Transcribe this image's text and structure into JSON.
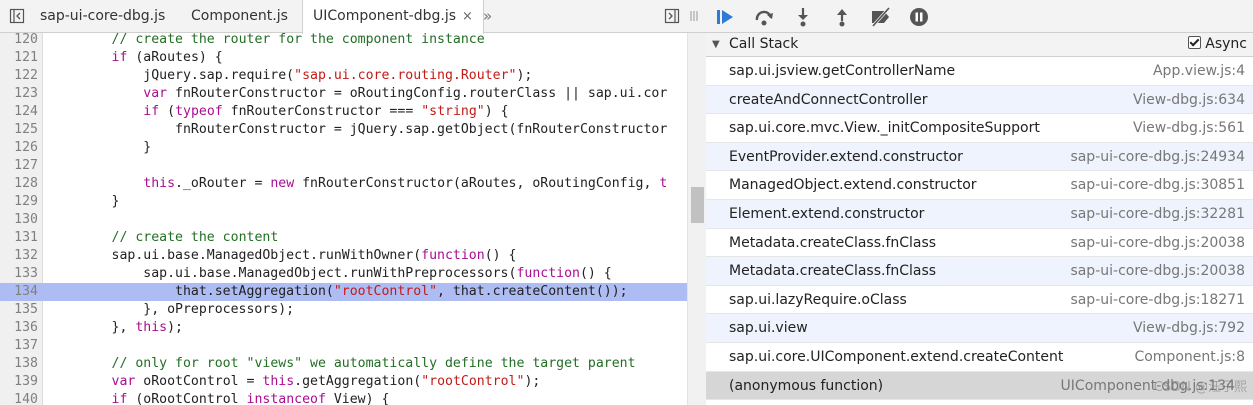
{
  "editor": {
    "tabs": [
      {
        "label": "sap-ui-core-dbg.js",
        "active": false
      },
      {
        "label": "Component.js",
        "active": false
      },
      {
        "label": "UIComponent-dbg.js",
        "active": true
      }
    ],
    "close_glyph": "×",
    "more_glyph": "»",
    "lines": [
      {
        "n": "120",
        "parts": [
          [
            "        ",
            ""
          ],
          [
            "// create the router for the component instance",
            "com"
          ]
        ]
      },
      {
        "n": "121",
        "parts": [
          [
            "        ",
            ""
          ],
          [
            "if",
            "kw"
          ],
          [
            " (aRoutes) {",
            ""
          ]
        ]
      },
      {
        "n": "122",
        "parts": [
          [
            "            jQuery.sap.require(",
            ""
          ],
          [
            "\"sap.ui.core.routing.Router\"",
            "str"
          ],
          [
            ");",
            ""
          ]
        ]
      },
      {
        "n": "123",
        "parts": [
          [
            "            ",
            ""
          ],
          [
            "var",
            "kw"
          ],
          [
            " fnRouterConstructor = oRoutingConfig.routerClass || sap.ui.cor",
            ""
          ]
        ]
      },
      {
        "n": "124",
        "parts": [
          [
            "            ",
            ""
          ],
          [
            "if",
            "kw"
          ],
          [
            " (",
            ""
          ],
          [
            "typeof",
            "kw"
          ],
          [
            " fnRouterConstructor === ",
            ""
          ],
          [
            "\"string\"",
            "str"
          ],
          [
            ") {",
            ""
          ]
        ]
      },
      {
        "n": "125",
        "parts": [
          [
            "                fnRouterConstructor = jQuery.sap.getObject(fnRouterConstructor",
            ""
          ]
        ]
      },
      {
        "n": "126",
        "parts": [
          [
            "            }",
            ""
          ]
        ]
      },
      {
        "n": "127",
        "parts": [
          [
            "",
            ""
          ]
        ]
      },
      {
        "n": "128",
        "parts": [
          [
            "            ",
            ""
          ],
          [
            "this",
            "kw"
          ],
          [
            "._oRouter = ",
            ""
          ],
          [
            "new",
            "kw"
          ],
          [
            " fnRouterConstructor(aRoutes, oRoutingConfig, ",
            ""
          ],
          [
            "t",
            "kw"
          ]
        ]
      },
      {
        "n": "129",
        "parts": [
          [
            "        }",
            ""
          ]
        ]
      },
      {
        "n": "130",
        "parts": [
          [
            "",
            ""
          ]
        ]
      },
      {
        "n": "131",
        "parts": [
          [
            "        ",
            ""
          ],
          [
            "// create the content",
            "com"
          ]
        ]
      },
      {
        "n": "132",
        "parts": [
          [
            "        sap.ui.base.ManagedObject.runWithOwner(",
            ""
          ],
          [
            "function",
            "kw"
          ],
          [
            "() {",
            ""
          ]
        ]
      },
      {
        "n": "133",
        "parts": [
          [
            "            sap.ui.base.ManagedObject.runWithPreprocessors(",
            ""
          ],
          [
            "function",
            "kw"
          ],
          [
            "() {",
            ""
          ]
        ]
      },
      {
        "n": "134",
        "highlight": true,
        "parts": [
          [
            "                that.setAggregation(",
            ""
          ],
          [
            "\"rootControl\"",
            "str"
          ],
          [
            ", that.createContent());",
            ""
          ]
        ]
      },
      {
        "n": "135",
        "parts": [
          [
            "            }, oPreprocessors);",
            ""
          ]
        ]
      },
      {
        "n": "136",
        "parts": [
          [
            "        }, ",
            ""
          ],
          [
            "this",
            "kw"
          ],
          [
            ");",
            ""
          ]
        ]
      },
      {
        "n": "137",
        "parts": [
          [
            "",
            ""
          ]
        ]
      },
      {
        "n": "138",
        "parts": [
          [
            "        ",
            ""
          ],
          [
            "// only for root \"views\" we automatically define the target parent",
            "com"
          ]
        ]
      },
      {
        "n": "139",
        "parts": [
          [
            "        ",
            ""
          ],
          [
            "var",
            "kw"
          ],
          [
            " oRootControl = ",
            ""
          ],
          [
            "this",
            "kw"
          ],
          [
            ".getAggregation(",
            ""
          ],
          [
            "\"rootControl\"",
            "str"
          ],
          [
            ");",
            ""
          ]
        ]
      },
      {
        "n": "140",
        "parts": [
          [
            "        ",
            ""
          ],
          [
            "if",
            "kw"
          ],
          [
            " (oRootControl ",
            ""
          ],
          [
            "instanceof",
            "kw"
          ],
          [
            " View) {",
            ""
          ]
        ]
      }
    ]
  },
  "debugger": {
    "toolbar_icons": [
      "resume-icon",
      "step-over-icon",
      "step-into-icon",
      "step-out-icon",
      "deactivate-breakpoints-icon",
      "pause-on-exceptions-icon"
    ],
    "call_stack_title": "Call Stack",
    "async_label": "Async",
    "async_checked": true,
    "frames": [
      {
        "name": "sap.ui.jsview.getControllerName",
        "loc": "App.view.js:4"
      },
      {
        "name": "createAndConnectController",
        "loc": "View-dbg.js:634"
      },
      {
        "name": "sap.ui.core.mvc.View._initCompositeSupport",
        "loc": "View-dbg.js:561"
      },
      {
        "name": "EventProvider.extend.constructor",
        "loc": "sap-ui-core-dbg.js:24934"
      },
      {
        "name": "ManagedObject.extend.constructor",
        "loc": "sap-ui-core-dbg.js:30851"
      },
      {
        "name": "Element.extend.constructor",
        "loc": "sap-ui-core-dbg.js:32281"
      },
      {
        "name": "Metadata.createClass.fnClass",
        "loc": "sap-ui-core-dbg.js:20038"
      },
      {
        "name": "Metadata.createClass.fnClass",
        "loc": "sap-ui-core-dbg.js:20038"
      },
      {
        "name": "sap.ui.lazyRequire.oClass",
        "loc": "sap-ui-core-dbg.js:18271"
      },
      {
        "name": "sap.ui.view",
        "loc": "View-dbg.js:792"
      },
      {
        "name": "sap.ui.core.UIComponent.extend.createContent",
        "loc": "Component.js:8"
      },
      {
        "name": "(anonymous function)",
        "loc": "UIComponent-dbg.js:134",
        "selected": true
      }
    ],
    "watermark": "CSDN @汪子熙"
  }
}
